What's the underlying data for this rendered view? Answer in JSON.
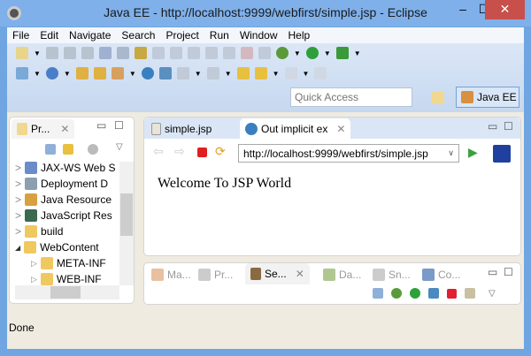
{
  "window": {
    "title": "Java EE - http://localhost:9999/webfirst/simple.jsp - Eclipse",
    "minimize": "–",
    "maximize": "☐",
    "close": "✕"
  },
  "menu": [
    "File",
    "Edit",
    "Navigate",
    "Search",
    "Project",
    "Run",
    "Window",
    "Help"
  ],
  "quick_access": {
    "placeholder": "Quick Access"
  },
  "perspective": {
    "label": "Java EE"
  },
  "explorer": {
    "tab": "Pr...",
    "items": [
      {
        "label": "JAX-WS Web S",
        "expander": ">"
      },
      {
        "label": "Deployment D",
        "expander": ">"
      },
      {
        "label": "Java Resource",
        "expander": ">"
      },
      {
        "label": "JavaScript Res",
        "expander": ">"
      },
      {
        "label": "build",
        "expander": ">"
      },
      {
        "label": "WebContent",
        "expander": "◢"
      },
      {
        "label": "META-INF",
        "expander": "▷"
      },
      {
        "label": "WEB-INF",
        "expander": "▷"
      }
    ]
  },
  "editor": {
    "tabs": [
      {
        "label": "simple.jsp"
      },
      {
        "label": "Out implicit ex"
      }
    ],
    "url": "http://localhost:9999/webfirst/simple.jsp",
    "content": "Welcome To JSP World"
  },
  "bottom": {
    "tabs": [
      "Ma...",
      "Pr...",
      "Se...",
      "Da...",
      "Sn...",
      "Co..."
    ]
  },
  "status": "Done"
}
